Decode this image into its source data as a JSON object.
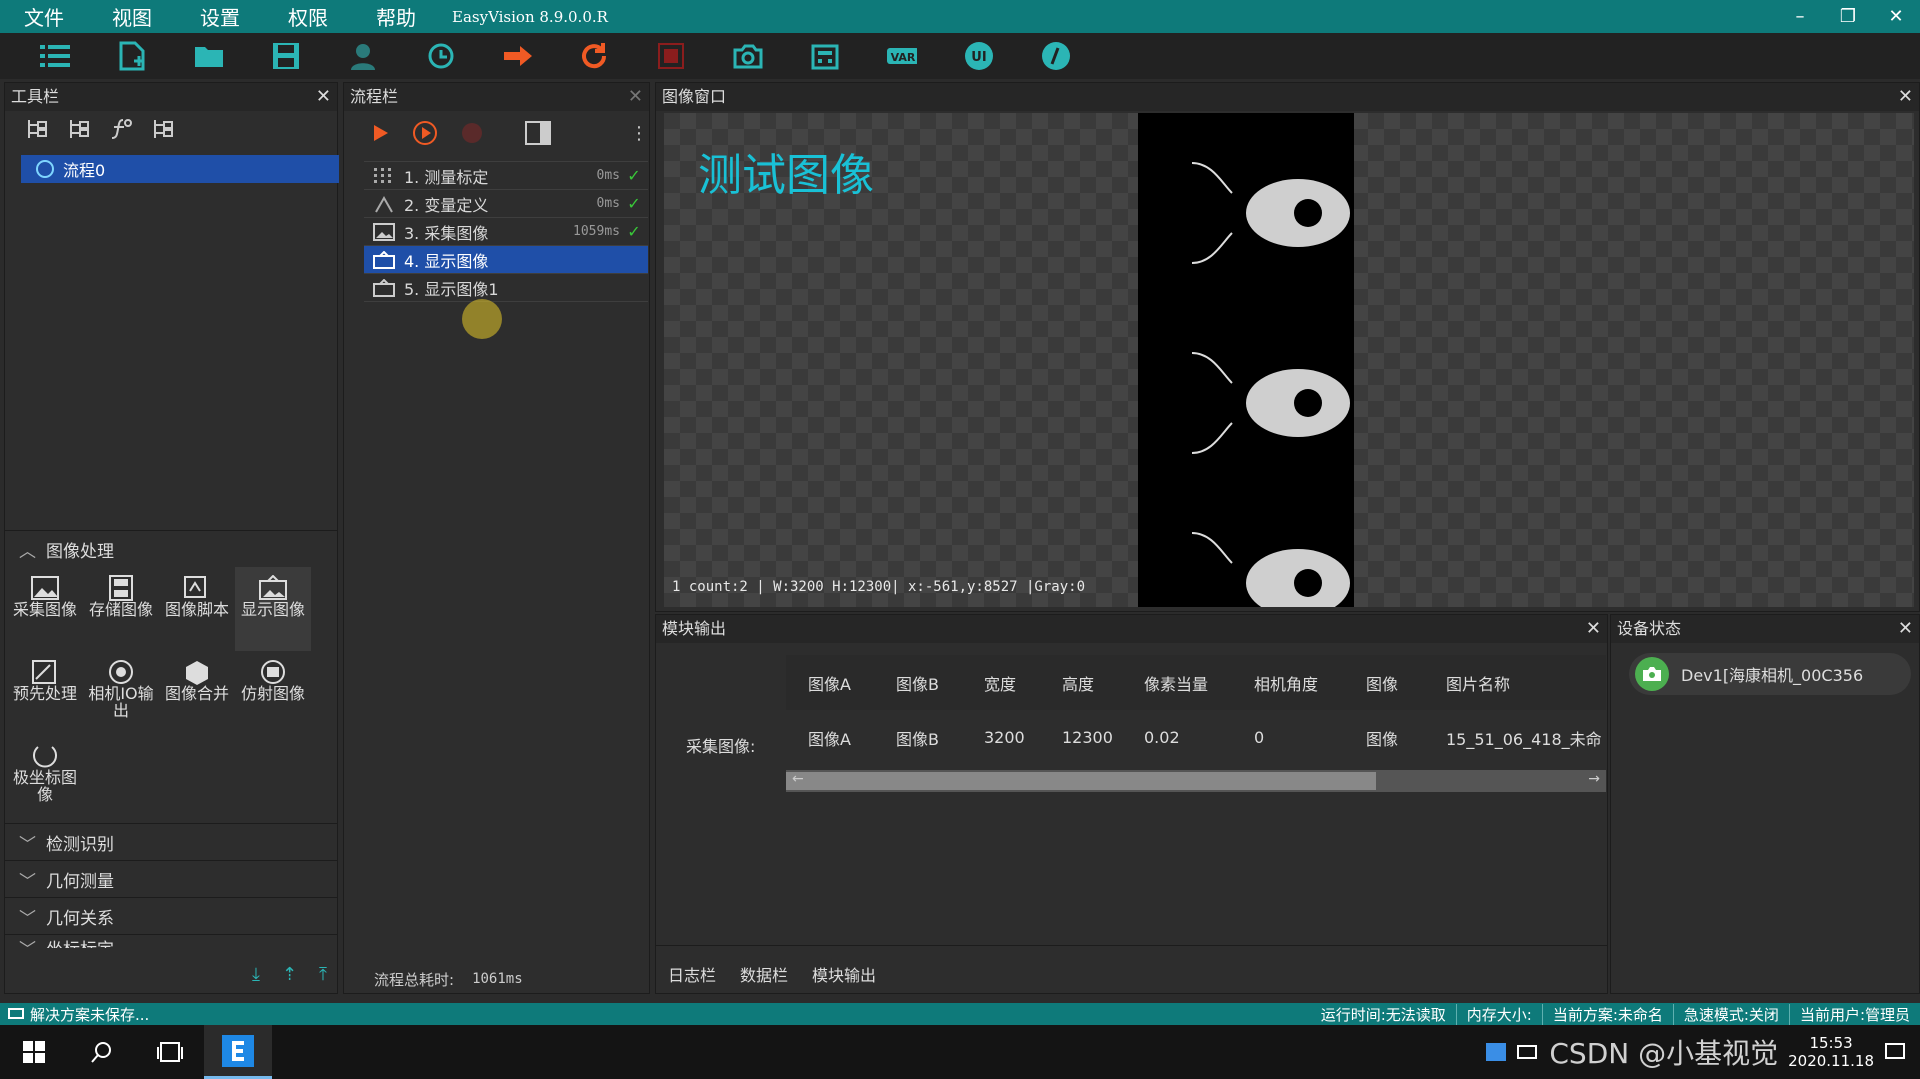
{
  "menubar": {
    "items": [
      "文件",
      "视图",
      "设置",
      "权限",
      "帮助"
    ],
    "app_title": "EasyVision 8.9.0.0.R"
  },
  "toolbar": {
    "icons": [
      "list-icon",
      "new-file-icon",
      "open-folder-icon",
      "save-icon",
      "user-icon",
      "history-icon",
      "arrow-right-icon",
      "refresh-icon",
      "stop-icon",
      "camera-icon",
      "calculator-icon",
      "var-icon",
      "ui-icon",
      "info-icon"
    ],
    "var_label": "VAR",
    "ui_label": "UI"
  },
  "tool_panel": {
    "title": "工具栏",
    "tree_item": "流程0",
    "section_image": "图像处理",
    "tools": [
      "采集图像",
      "存储图像",
      "图像脚本",
      "显示图像",
      "预先处理",
      "相机IO输出",
      "图像合并",
      "仿射图像",
      "极坐标图像"
    ],
    "sections": [
      "检测识别",
      "几何测量",
      "几何关系",
      "坐标标定"
    ]
  },
  "flow_panel": {
    "title": "流程栏",
    "rows": [
      {
        "label": "1. 测量标定",
        "time": "0ms",
        "ok": true
      },
      {
        "label": "2. 变量定义",
        "time": "0ms",
        "ok": true
      },
      {
        "label": "3. 采集图像",
        "time": "1059ms",
        "ok": true
      },
      {
        "label": "4. 显示图像",
        "time": "",
        "ok": false
      },
      {
        "label": "5. 显示图像1",
        "time": "",
        "ok": false
      }
    ],
    "total_label": "流程总耗时:",
    "total_value": "1061ms"
  },
  "image_window": {
    "title": "图像窗口",
    "overlay_title": "测试图像",
    "info": "1   count:2  | W:3200 H:12300| x:-561,y:8527 |Gray:0"
  },
  "module_output": {
    "title": "模块输出",
    "row_label": "采集图像:",
    "columns": [
      "图像A",
      "图像B",
      "宽度",
      "高度",
      "像素当量",
      "相机角度",
      "图像",
      "图片名称"
    ],
    "values": [
      "图像A",
      "图像B",
      "3200",
      "12300",
      "0.02",
      "0",
      "图像",
      "15_51_06_418_未命"
    ],
    "tabs": [
      "日志栏",
      "数据栏",
      "模块输出"
    ]
  },
  "device_panel": {
    "title": "设备状态",
    "device": "Dev1[海康相机_00C356"
  },
  "statusbar": {
    "left": "解决方案未保存...",
    "items": [
      "运行时间:无法读取",
      "内存大小:",
      "当前方案:未命名",
      "急速模式:关闭",
      "当前用户:管理员"
    ]
  },
  "taskbar": {
    "watermark": "CSDN @小基视觉",
    "time": "15:53",
    "date": "2020.11.18"
  },
  "colors": {
    "accent": "#0e7a7a",
    "selection": "#1f4fa8",
    "title_text": "#19c1d6"
  }
}
